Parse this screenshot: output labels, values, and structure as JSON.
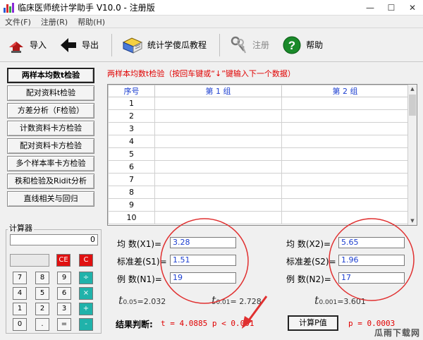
{
  "window": {
    "title": "临床医师统计学助手 V10.0 - 注册版",
    "controls": [
      "—",
      "☐",
      "✕"
    ]
  },
  "menu": [
    "文件(F)",
    "注册(R)",
    "帮助(H)"
  ],
  "toolbar": {
    "import": "导入",
    "export": "导出",
    "tutorial": "统计学傻瓜教程",
    "register": "注册",
    "help": "帮助"
  },
  "left_buttons": [
    "两样本均数t检验",
    "配对资料t检验",
    "方差分析（F检验）",
    "计数资料卡方检验",
    "配对资料卡方检验",
    "多个样本率卡方检验",
    "秩和检验及Ridit分析",
    "直线相关与回归"
  ],
  "calculator": {
    "title": "计算器",
    "display": "0",
    "keys": [
      "CE",
      "C",
      "7",
      "8",
      "9",
      "÷",
      "4",
      "5",
      "6",
      "×",
      "1",
      "2",
      "3",
      "+",
      "0",
      ".",
      "=",
      "-"
    ]
  },
  "main": {
    "hint": "两样本均数t检验（按回车键或“↓”键输入下一个数据）",
    "table": {
      "headers": [
        "序号",
        "第 1 组",
        "第 2 组"
      ],
      "rows": [
        "1",
        "2",
        "3",
        "4",
        "5",
        "6",
        "7",
        "8",
        "9",
        "10"
      ]
    },
    "stats": {
      "mean1_label": "均  数(X1)=",
      "mean1": "3.28",
      "sd1_label": "标准差(S1)=",
      "sd1": "1.51",
      "n1_label": "例  数(N1)=",
      "n1": "19",
      "mean2_label": "均  数(X2)=",
      "mean2": "5.65",
      "sd2_label": "标准差(S2)=",
      "sd2": "1.96",
      "n2_label": "例  数(N2)=",
      "n2": "17"
    },
    "t_crit": [
      {
        "sym": "t",
        "sub": "0.05",
        "val": "=2.032"
      },
      {
        "sym": "t",
        "sub": "0.01",
        "val": "= 2.728"
      },
      {
        "sym": "t",
        "sub": "0.001",
        "val": "=3.601"
      }
    ],
    "result_label": "结果判断:",
    "result_text": "t = 4.0885  p < 0.001",
    "calc_p_button": "计算P值",
    "p_value": "p = 0.0003"
  },
  "watermark": "瓜雨下载网",
  "colors": {
    "accent_red": "#e00000",
    "value_blue": "#1e40d0",
    "key_red": "#e01010",
    "key_teal": "#20b2aa"
  }
}
